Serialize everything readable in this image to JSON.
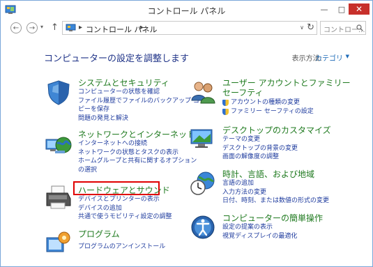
{
  "window": {
    "title": "コントロール パネル",
    "minimize": "—",
    "maximize": "□",
    "close": "✕"
  },
  "navbar": {
    "back": "←",
    "forward": "→",
    "history": "▾",
    "up": "↑",
    "address_sep1": "▸",
    "address": "コントロール パネル",
    "address_sep2": "▸",
    "address_dropdown": "∨",
    "refresh": "↻",
    "search_placeholder": "コントロー..."
  },
  "main": {
    "heading": "コンピューターの設定を調整します",
    "view_by_label": "表示方法:",
    "view_by_value": "カテゴリ",
    "view_by_arrow": "▼"
  },
  "categories": {
    "system": {
      "title": "システムとセキュリティ",
      "links": [
        "コンピューターの状態を確認",
        "ファイル履歴でファイルのバックアップ コ",
        "ピーを保存",
        "問題の発見と解決"
      ],
      "icon": "shield-icon"
    },
    "network": {
      "title": "ネットワークとインターネット",
      "links": [
        "インターネットへの接続",
        "ネットワークの状態とタスクの表示",
        "ホームグループと共有に関するオプション",
        "の選択"
      ],
      "icon": "network-globe-icon"
    },
    "hardware": {
      "title": "ハードウェアとサウンド",
      "links": [
        "デバイスとプリンターの表示",
        "デバイスの追加",
        "共通で使うモビリティ設定の調整"
      ],
      "icon": "printer-icon"
    },
    "programs": {
      "title": "プログラム",
      "links": [
        "プログラムのアンインストール"
      ],
      "icon": "programs-icon"
    },
    "users": {
      "title1": "ユーザー アカウントとファミリー",
      "title2": "セーフティ",
      "links": [
        "アカウントの種類の変更",
        "ファミリー セーフティの設定"
      ],
      "icon": "users-icon"
    },
    "appearance": {
      "title": "デスクトップのカスタマイズ",
      "links": [
        "テーマの変更",
        "デスクトップの背景の変更",
        "画面の解像度の調整"
      ],
      "icon": "desktop-icon"
    },
    "clock": {
      "title": "時計、言語、および地域",
      "links": [
        "言語の追加",
        "入力方法の変更",
        "日付、時刻、または数値の形式の変更"
      ],
      "icon": "clock-globe-icon"
    },
    "ease": {
      "title": "コンピューターの簡単操作",
      "links": [
        "設定の提案の表示",
        "視覚ディスプレイの最適化"
      ],
      "icon": "ease-of-access-icon"
    }
  },
  "colors": {
    "category_title": "#1f7a1f",
    "link": "#1e3b9e",
    "heading": "#1e3287",
    "highlight": "#e00000",
    "close_button": "#c7302b"
  }
}
